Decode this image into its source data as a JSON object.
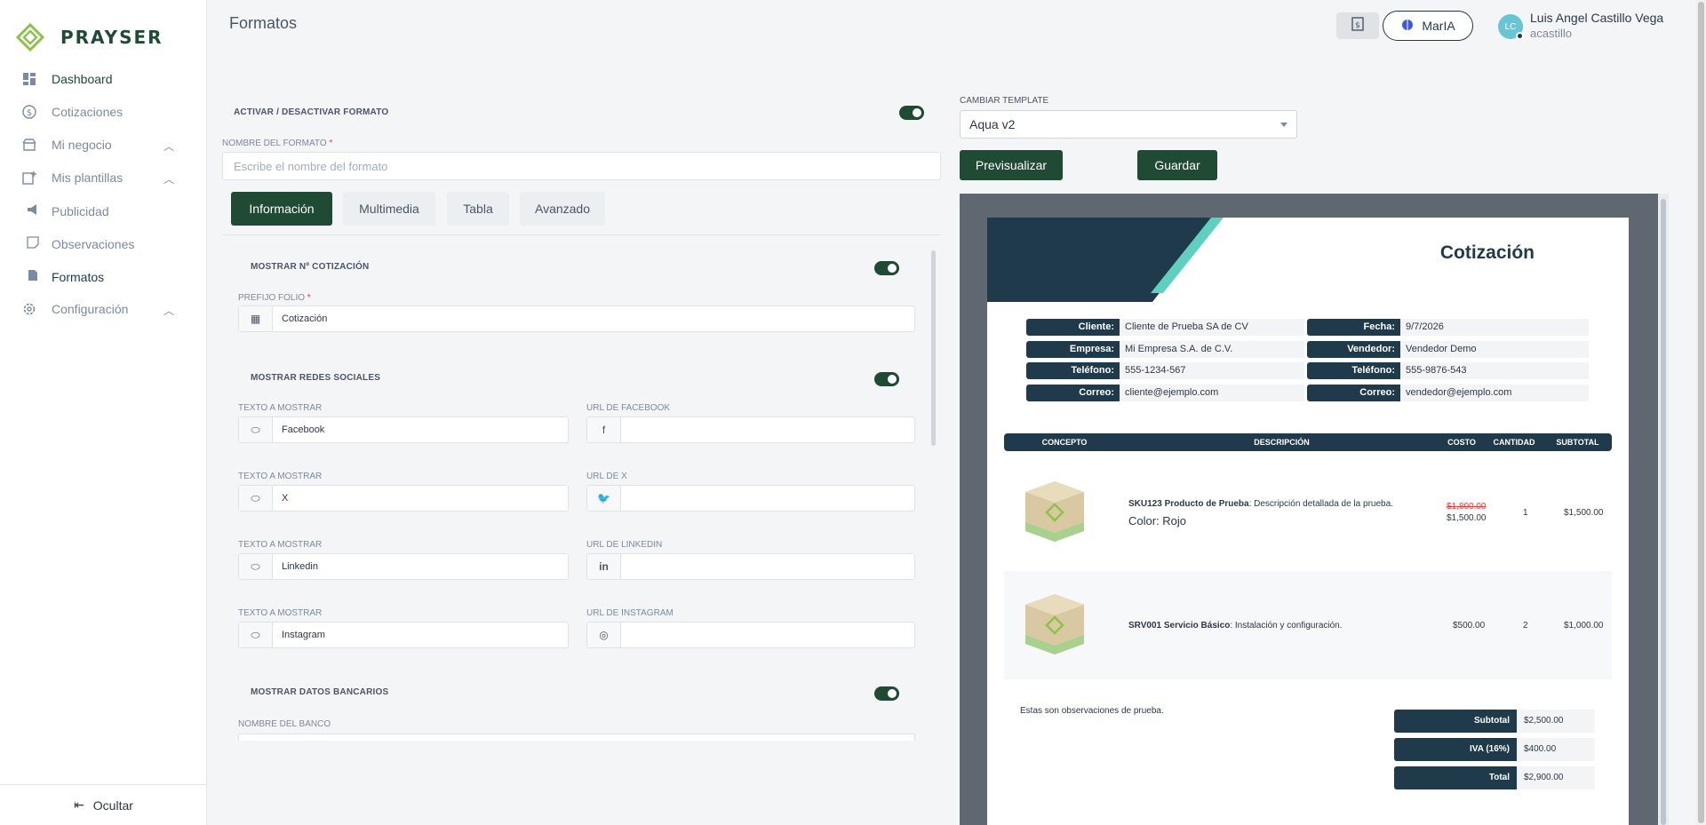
{
  "brand": {
    "name": "PRAYSER",
    "accent": "#1f4a34",
    "logo_green": "#8bc34a"
  },
  "sidebar": {
    "items": [
      {
        "label": "Dashboard"
      },
      {
        "label": "Cotizaciones"
      },
      {
        "label": "Mi negocio"
      },
      {
        "label": "Mis plantillas"
      },
      {
        "label": "Publicidad"
      },
      {
        "label": "Observaciones"
      },
      {
        "label": "Formatos"
      },
      {
        "label": "Configuración"
      }
    ],
    "footer_label": "Ocultar"
  },
  "header": {
    "title": "Formatos",
    "maria_label": "MarIA",
    "user_name": "Luis Angel Castillo Vega",
    "user_login": "acastillo",
    "avatar_initials": "LC"
  },
  "form": {
    "toggle_format_label": "ACTIVAR / DESACTIVAR FORMATO",
    "name_label": "NOMBRE DEL FORMATO",
    "name_placeholder": "Escribe el nombre del formato",
    "tabs": [
      {
        "label": "Información"
      },
      {
        "label": "Multimedia"
      },
      {
        "label": "Tabla"
      },
      {
        "label": "Avanzado"
      }
    ],
    "show_number_label": "MOSTRAR Nº COTIZACIÓN",
    "prefix_label": "PREFIJO FOLIO",
    "prefix_value": "Cotización",
    "show_social_label": "MOSTRAR REDES SOCIALES",
    "text_label": "TEXTO A MOSTRAR",
    "social": [
      {
        "text": "Facebook",
        "url_label": "URL DE FACEBOOK",
        "icon": "f"
      },
      {
        "text": "X",
        "url_label": "URL DE X",
        "icon": "🐦"
      },
      {
        "text": "Linkedin",
        "url_label": "URL DE LINKEDIN",
        "icon": "in"
      },
      {
        "text": "Instagram",
        "url_label": "URL DE INSTAGRAM",
        "icon": "◎"
      }
    ],
    "show_bank_label": "MOSTRAR DATOS BANCARIOS",
    "bank_name_label": "NOMBRE DEL BANCO"
  },
  "template": {
    "label": "CAMBIAR TEMPLATE",
    "value": "Aqua v2",
    "preview_label": "Previsualizar",
    "save_label": "Guardar"
  },
  "preview": {
    "title": "Cotización",
    "left": [
      {
        "label": "Cliente:",
        "value": "Cliente de Prueba SA de CV"
      },
      {
        "label": "Empresa:",
        "value": "Mi Empresa S.A. de C.V."
      },
      {
        "label": "Teléfono:",
        "value": "555-1234-567"
      },
      {
        "label": "Correo:",
        "value": "cliente@ejemplo.com"
      }
    ],
    "right": [
      {
        "label": "Fecha:",
        "value": "9/7/2026"
      },
      {
        "label": "Vendedor:",
        "value": "Vendedor Demo"
      },
      {
        "label": "Teléfono:",
        "value": "555-9876-543"
      },
      {
        "label": "Correo:",
        "value": "vendedor@ejemplo.com"
      }
    ],
    "columns": [
      "CONCEPTO",
      "DESCRIPCIÓN",
      "COSTO",
      "CANTIDAD",
      "SUBTOTAL"
    ],
    "rows": [
      {
        "sku": "SKU123 Producto de Prueba",
        "desc": ": Descripción detallada de la prueba.",
        "extra": "Color: Rojo",
        "old_price": "$1,800.00",
        "price": "$1,500.00",
        "qty": "1",
        "subtotal": "$1,500.00"
      },
      {
        "sku": "SRV001 Servicio Básico",
        "desc": ": Instalación y configuración.",
        "extra": "",
        "old_price": "",
        "price": "$500.00",
        "qty": "2",
        "subtotal": "$1,000.00"
      }
    ],
    "observations": "Estas son observaciones de prueba.",
    "totals": [
      {
        "label": "Subtotal",
        "value": "$2,500.00"
      },
      {
        "label": "IVA (16%)",
        "value": "$400.00"
      },
      {
        "label": "Total",
        "value": "$2,900.00"
      }
    ]
  }
}
